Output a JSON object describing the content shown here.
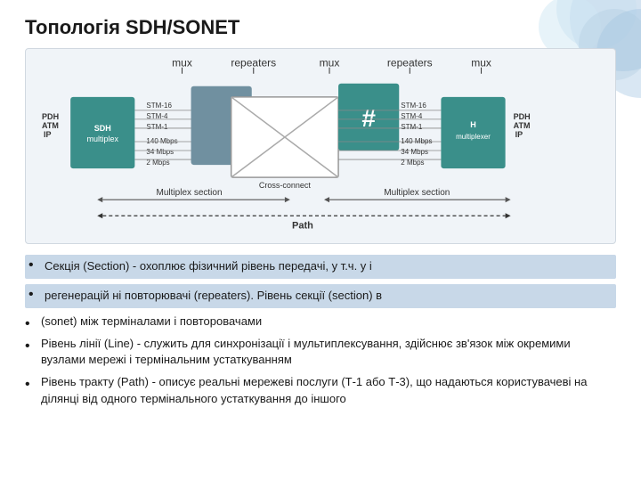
{
  "page": {
    "title": "Топологія SDH/SONET"
  },
  "diagram": {
    "labels": {
      "mux1": "mux",
      "repeaters1": "repeaters",
      "mux2": "mux",
      "repeaters2": "repeaters",
      "mux3": "mux"
    },
    "left_box": "SDH\nmultiplex",
    "right_box": "multiplexer",
    "center_label": "Cross-connect",
    "section_label1": "Multiplex section",
    "section_label2": "Multiplex section",
    "path_label": "Path",
    "pdh_atm_ip_left": "PDH\nATM\nIP",
    "pdh_atm_ip_right": "PDH\nATM\nIP",
    "rates": [
      "STM-16",
      "STM-4",
      "STM-1",
      "140 Mbps",
      "34 Mbps",
      "2 Mbps"
    ]
  },
  "bullets": [
    {
      "text": "Секція (Section) - охоплює фізичний рівень передачі, у т.ч. у і",
      "highlighted": true
    },
    {
      "text": "регенерацій ні повторювачі (repeaters). Рівень секції (section) в",
      "highlighted": true
    },
    {
      "text": "(sonet) між терміналами і повторовачами",
      "highlighted": false
    },
    {
      "text": "Рівень лінії (Line) - служить для синхронізації і мультиплексування, здійснює зв'язок між окремими вузлами мережі і термінальним устаткуванням",
      "highlighted": false
    },
    {
      "text": "Рівень тракту (Path) - описує реальні мережеві послуги (Т-1 або Т-3), що надаються користувачеві на ділянці від одного термінального устаткування до іншого",
      "highlighted": false
    }
  ]
}
